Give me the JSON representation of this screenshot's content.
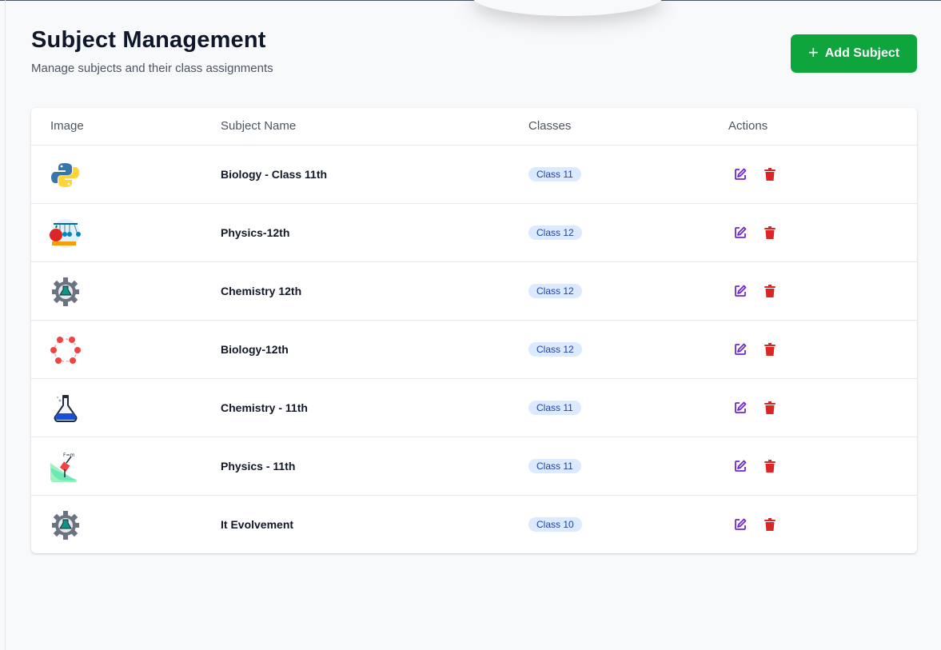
{
  "page": {
    "title": "Subject Management",
    "subtitle": "Manage subjects and their class assignments",
    "add_button_label": "Add Subject"
  },
  "table": {
    "headers": [
      "Image",
      "Subject Name",
      "Classes",
      "Actions"
    ],
    "rows": [
      {
        "name": "Biology - Class 11th",
        "class": "Class 11",
        "icon": "python-logo-icon"
      },
      {
        "name": "Physics-12th",
        "class": "Class 12",
        "icon": "newtons-cradle-icon"
      },
      {
        "name": "Chemistry 12th",
        "class": "Class 12",
        "icon": "gear-flask-icon"
      },
      {
        "name": "Biology-12th",
        "class": "Class 12",
        "icon": "molecule-ring-icon"
      },
      {
        "name": "Chemistry - 11th",
        "class": "Class 11",
        "icon": "flask-icon"
      },
      {
        "name": "Physics - 11th",
        "class": "Class 11",
        "icon": "force-diagram-icon"
      },
      {
        "name": "It Evolvement",
        "class": "Class 10",
        "icon": "gear-flask-icon"
      }
    ]
  },
  "colors": {
    "accent_green": "#0ea53d",
    "edit_purple": "#6d28d9",
    "delete_red": "#dc2626",
    "badge_bg": "#dbeafe",
    "badge_text": "#1e40af"
  }
}
